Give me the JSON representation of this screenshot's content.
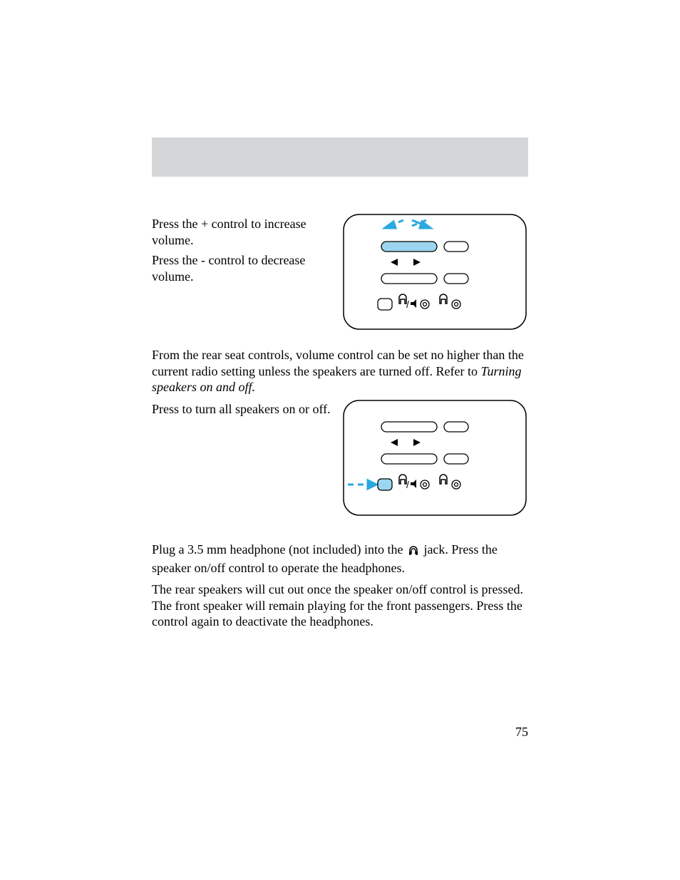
{
  "section1": {
    "p1": "Press the + control to increase volume.",
    "p2": "Press the - control to decrease volume."
  },
  "section2": {
    "note_pre": "From the rear seat controls, volume control can be set no higher than the current radio setting unless the speakers are turned off. Refer to ",
    "note_italic": "Turning speakers on and off."
  },
  "section3": {
    "p1": "Press to turn all speakers on or off."
  },
  "section4": {
    "p1_pre": "Plug a 3.5 mm headphone (not included) into the ",
    "p1_post": " jack. Press the speaker on/off control to operate the headphones.",
    "p2": "The rear speakers will cut out once the speaker on/off control is pressed. The front speaker will remain playing for the front passengers. Press the control again to deactivate the headphones."
  },
  "page_number": "75",
  "colors": {
    "accent": "#2aa8e0",
    "accent_fill": "#9bd5ef"
  }
}
